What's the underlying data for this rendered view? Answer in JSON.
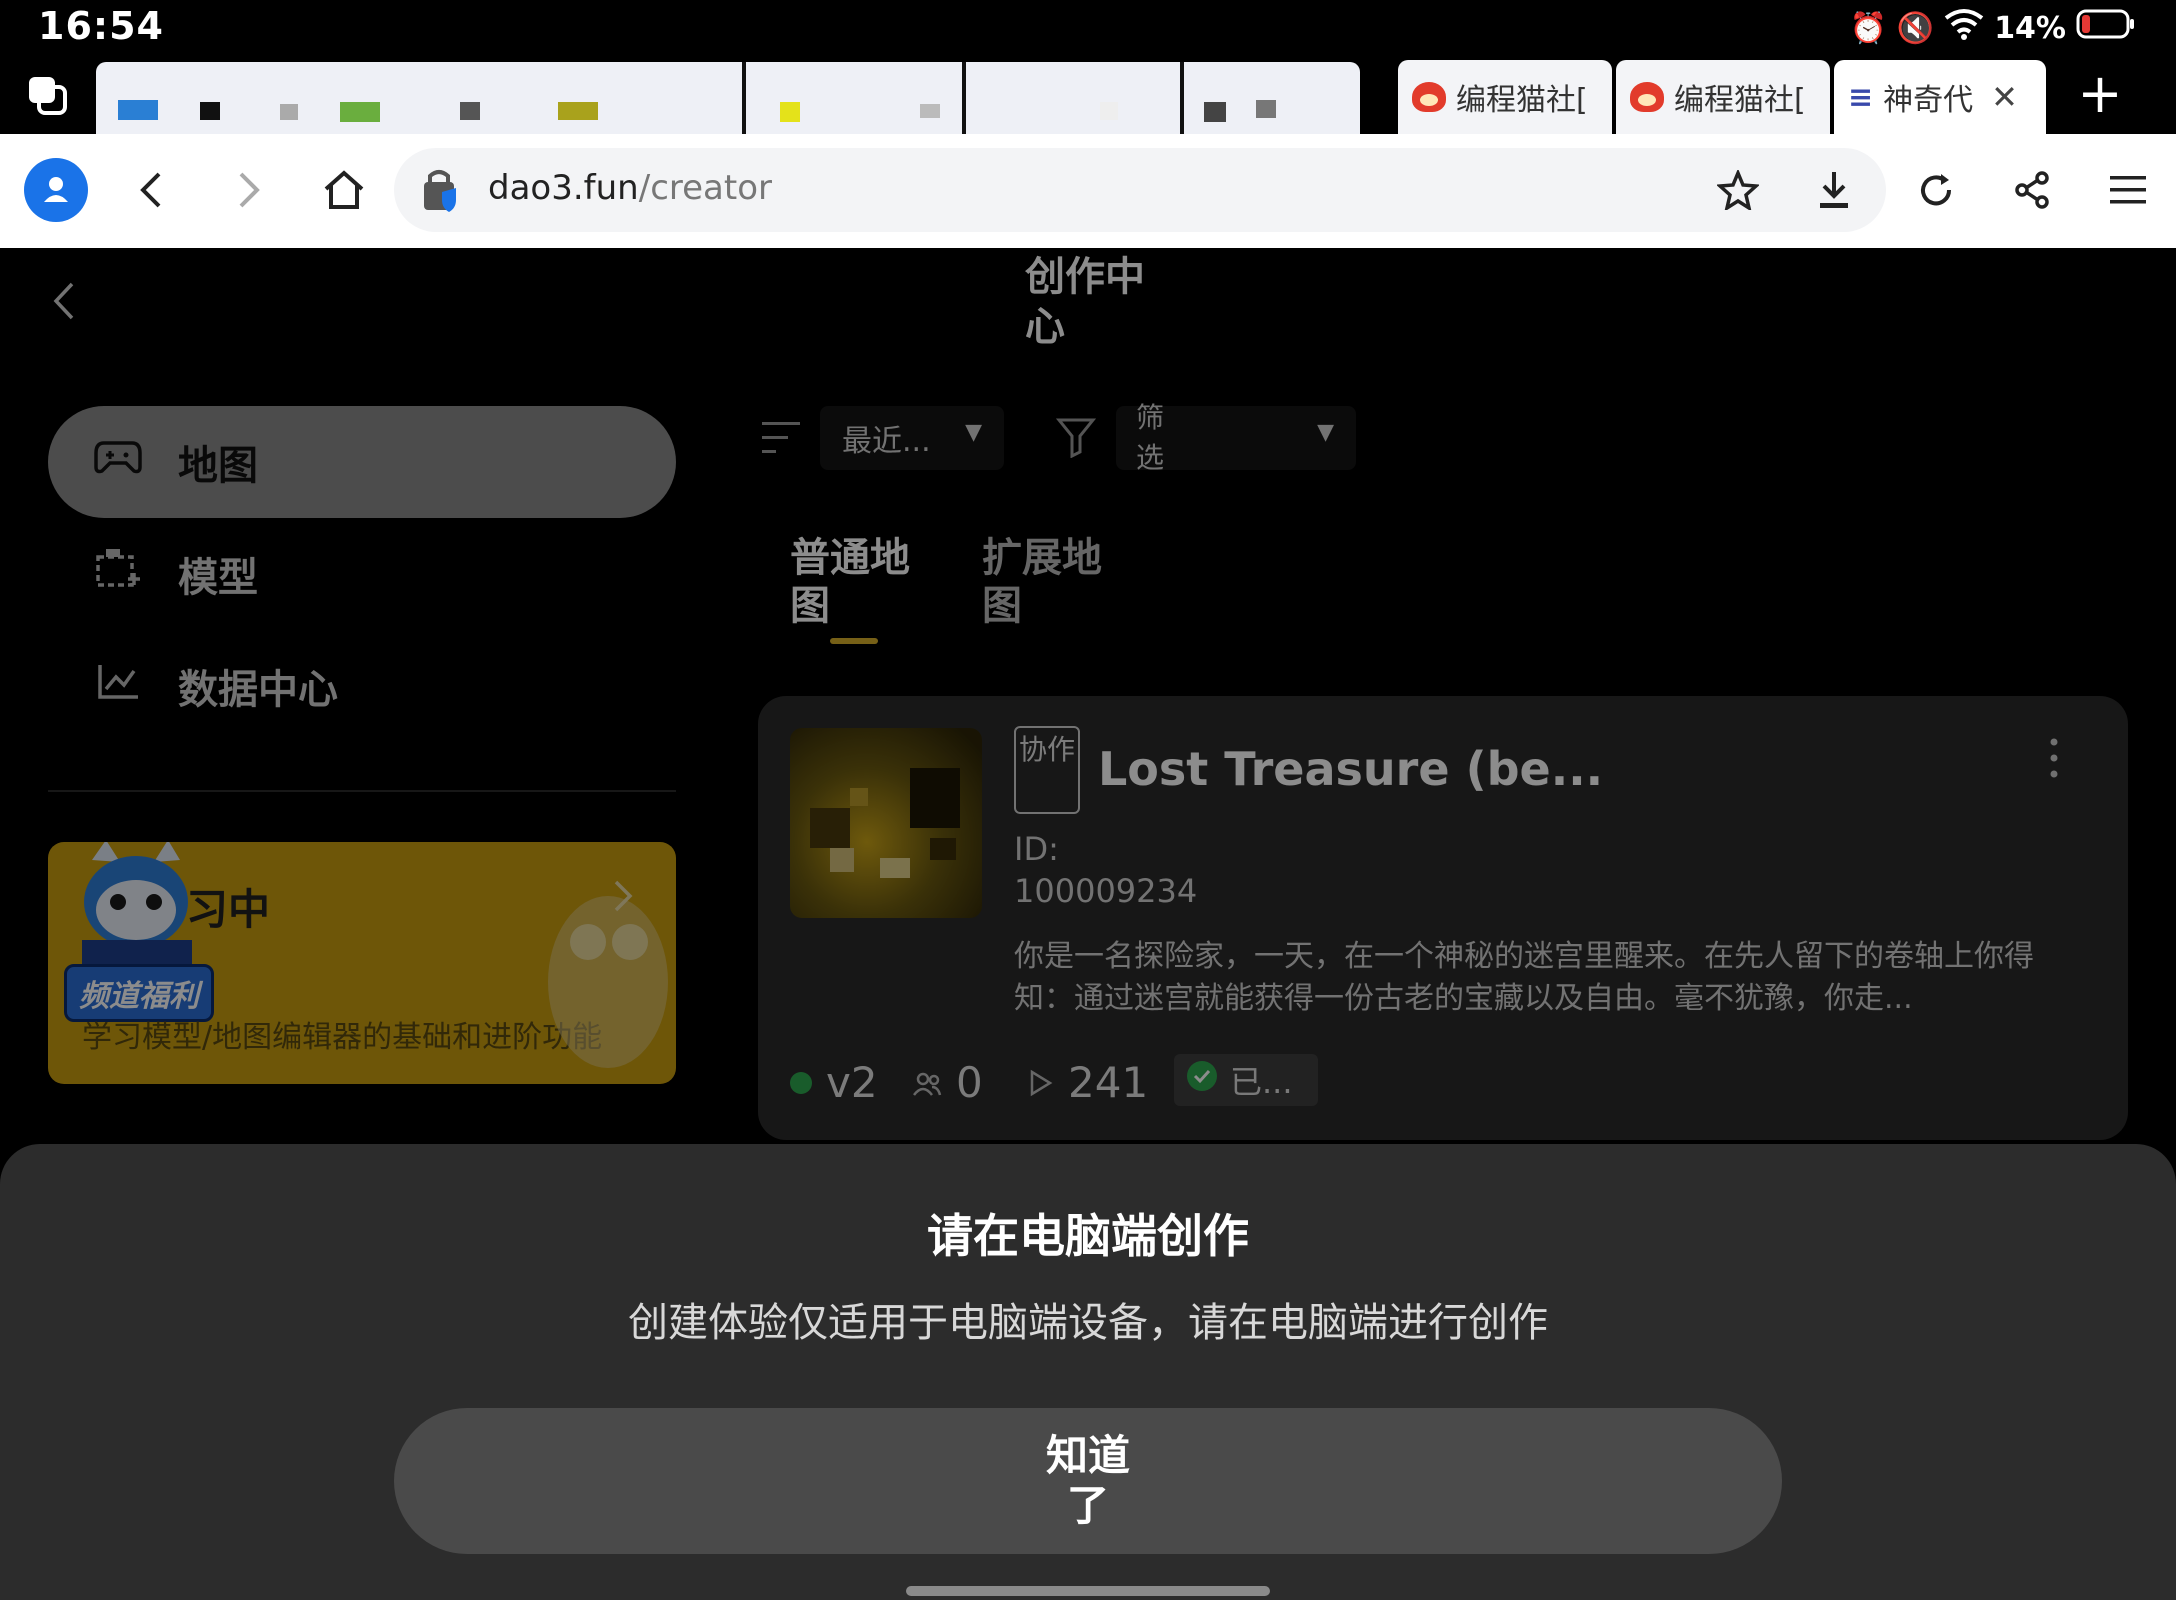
{
  "status_bar": {
    "time": "16:54",
    "battery": "14%",
    "battery_color": "#e53935"
  },
  "tabs": [
    {
      "label": "编程猫社[",
      "icon": "codemao-icon"
    },
    {
      "label": "编程猫社[",
      "icon": "codemao-icon"
    },
    {
      "label": "神奇代",
      "icon": "app-icon",
      "active": true
    }
  ],
  "toolbar": {
    "url_domain": "dao3.fun",
    "url_path": "/creator"
  },
  "page": {
    "title": "创作中心",
    "sidebar": {
      "items": [
        {
          "label": "地图",
          "icon": "gamepad-icon",
          "active": true
        },
        {
          "label": "模型",
          "icon": "model-icon",
          "active": false
        },
        {
          "label": "数据中心",
          "icon": "chart-icon",
          "active": false
        }
      ],
      "banner": {
        "heading": "习中",
        "badge": "频道福利",
        "text": "学习模型/地图编辑器的基础和进阶功能"
      }
    },
    "sort_select": {
      "value": "最近..."
    },
    "filter_select": {
      "value": "筛选"
    },
    "subtabs": [
      {
        "label": "普通地图",
        "active": true
      },
      {
        "label": "扩展地图",
        "active": false
      }
    ],
    "card": {
      "badge": "协作",
      "title": "Lost Treasure (be...",
      "id_label": "ID:",
      "id_value": "100009234",
      "description": "你是一名探险家，一天，在一个神秘的迷宫里醒来。在先人留下的卷轴上你得知：通过迷宫就能获得一份古老的宝藏以及自由。毫不犹豫，你走...",
      "version": "v2",
      "players": "0",
      "plays": "241",
      "status": "已...",
      "status_color": "#2fa84f",
      "version_dot_color": "#2fa84f"
    }
  },
  "dialog": {
    "title": "请在电脑端创作",
    "message": "创建体验仅适用于电脑端设备，请在电脑端进行创作",
    "ok_label": "知道了"
  }
}
